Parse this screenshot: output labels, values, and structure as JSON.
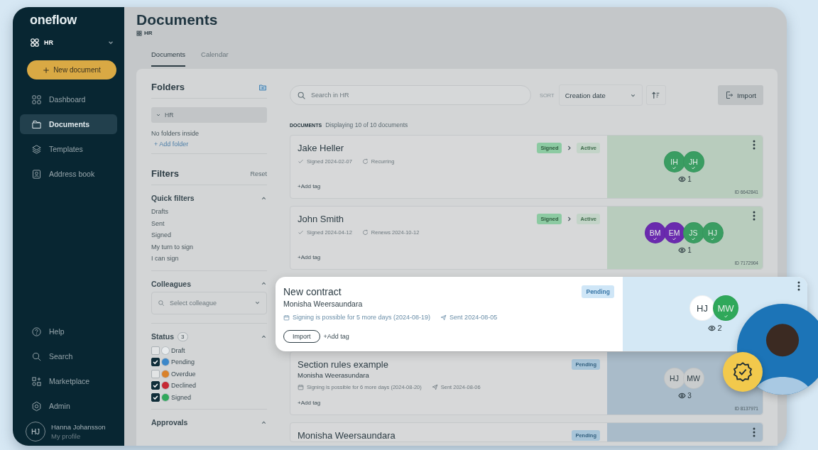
{
  "sidebar": {
    "logo": "oneflow",
    "workspace": "HR",
    "new_button": "New document",
    "nav": [
      {
        "label": "Dashboard",
        "kind": "grid",
        "selected": false
      },
      {
        "label": "Documents",
        "kind": "folder",
        "selected": true
      },
      {
        "label": "Templates",
        "kind": "layers",
        "selected": false
      },
      {
        "label": "Address book",
        "kind": "contact",
        "selected": false
      }
    ],
    "bottom_nav": [
      {
        "label": "Help",
        "kind": "help",
        "selected": false
      },
      {
        "label": "Search",
        "kind": "search",
        "selected": false
      },
      {
        "label": "Marketplace",
        "kind": "apps",
        "selected": false
      },
      {
        "label": "Admin",
        "kind": "gear",
        "selected": false
      }
    ],
    "profile": {
      "initials": "HJ",
      "name": "Hanna Johansson",
      "link": "My profile"
    }
  },
  "header": {
    "title": "Documents",
    "breadcrumb": "HR",
    "tabs": [
      {
        "label": "Documents",
        "selected": true
      },
      {
        "label": "Calendar",
        "selected": false
      }
    ]
  },
  "folders": {
    "title": "Folders",
    "items": [
      {
        "label": "HR",
        "expanded": true,
        "selected": true
      }
    ],
    "empty_text": "No folders inside",
    "add": "+ Add folder"
  },
  "filters": {
    "title": "Filters",
    "reset": "Reset",
    "sections": [
      {
        "title": "Quick filters",
        "kind": "links",
        "expanded": true,
        "items": [
          {
            "label": "Drafts"
          },
          {
            "label": "Sent"
          },
          {
            "label": "Signed"
          },
          {
            "label": "My turn to sign"
          },
          {
            "label": "I can sign"
          }
        ]
      },
      {
        "title": "Colleagues",
        "kind": "select",
        "expanded": true,
        "placeholder": "Select colleague"
      },
      {
        "title": "Status",
        "kind": "checks",
        "expanded": true,
        "count": "3",
        "items": [
          {
            "label": "Draft",
            "checked": false,
            "color": "#e8ebed"
          },
          {
            "label": "Pending",
            "checked": true,
            "color": "#3b87c9"
          },
          {
            "label": "Overdue",
            "checked": false,
            "color": "#d9822b"
          },
          {
            "label": "Declined",
            "checked": true,
            "color": "#c62a35"
          },
          {
            "label": "Signed",
            "checked": true,
            "color": "#31a85c"
          }
        ]
      },
      {
        "title": "Approvals",
        "kind": "links",
        "expanded": true
      }
    ]
  },
  "toolbar": {
    "search_placeholder": "Search in HR",
    "sort_label": "SORT",
    "sort_value": "Creation date",
    "import": "Import"
  },
  "list_header": {
    "label": "DOCUMENTS",
    "count": "Displaying 10 of 10 documents"
  },
  "documents": [
    {
      "title": "Jake Heller",
      "kind": "signed",
      "highlighted": false,
      "meta": [
        {
          "kind": "signed",
          "text": "Signed 2024-02-07"
        },
        {
          "kind": "recurring",
          "text": "Recurring"
        }
      ],
      "statuses": [
        {
          "label": "Signed",
          "kind": "signed"
        },
        {
          "label": "Active",
          "kind": "active"
        }
      ],
      "tag": "+Add tag",
      "participants": [
        {
          "initials": "IH",
          "color": "#3a9d62",
          "signed": true
        },
        {
          "initials": "JH",
          "color": "#3a9d62",
          "signed": true
        }
      ],
      "views": "1",
      "id": "ID 6642841"
    },
    {
      "title": "John Smith",
      "kind": "signed",
      "highlighted": false,
      "meta": [
        {
          "kind": "signed",
          "text": "Signed 2024-04-12"
        },
        {
          "kind": "recurring",
          "text": "Renews 2024-10-12"
        }
      ],
      "statuses": [
        {
          "label": "Signed",
          "kind": "signed"
        },
        {
          "label": "Active",
          "kind": "active"
        }
      ],
      "tag": "+Add tag",
      "participants": [
        {
          "initials": "BM",
          "color": "#6a2aae",
          "signed": true
        },
        {
          "initials": "EM",
          "color": "#6a2aae",
          "signed": true
        },
        {
          "initials": "JS",
          "color": "#3a9d62",
          "signed": true
        },
        {
          "initials": "HJ",
          "color": "#3a9d62",
          "signed": true
        }
      ],
      "views": "1",
      "id": "ID 7172904"
    },
    {
      "title": "New contract",
      "subtitle": "Monisha Weersaundara",
      "kind": "pending",
      "highlighted": true,
      "meta": [
        {
          "kind": "deadline",
          "text": "Signing is possible for 5 more days (2024-08-19)"
        },
        {
          "kind": "sent",
          "text": "Sent 2024-08-05"
        }
      ],
      "statuses": [
        {
          "label": "Pending",
          "kind": "pending"
        }
      ],
      "import_button": "Import",
      "tag": "+Add tag",
      "participants": [
        {
          "initials": "HJ",
          "color": "#ffffff",
          "signed": false
        },
        {
          "initials": "MW",
          "color": "#2fa85a",
          "signed": true
        }
      ],
      "views": "2"
    },
    {
      "title": "Section rules example",
      "subtitle": "Monisha Weerasundara",
      "kind": "pending",
      "highlighted": false,
      "meta": [
        {
          "kind": "deadline",
          "text": "Signing is possible for 6 more days (2024-08-20)"
        },
        {
          "kind": "sent",
          "text": "Sent 2024-08-06"
        }
      ],
      "statuses": [
        {
          "label": "Pending",
          "kind": "pending"
        }
      ],
      "tag": "+Add tag",
      "participants": [
        {
          "initials": "HJ",
          "color": "#c9cccd",
          "signed": false
        },
        {
          "initials": "MW",
          "color": "#c9cccd",
          "signed": false
        }
      ],
      "views": "3",
      "id": "ID 8137971"
    },
    {
      "title": "Monisha Weersaundara",
      "kind": "pending",
      "highlighted": false,
      "statuses": [
        {
          "label": "Pending",
          "kind": "pending"
        }
      ]
    }
  ]
}
